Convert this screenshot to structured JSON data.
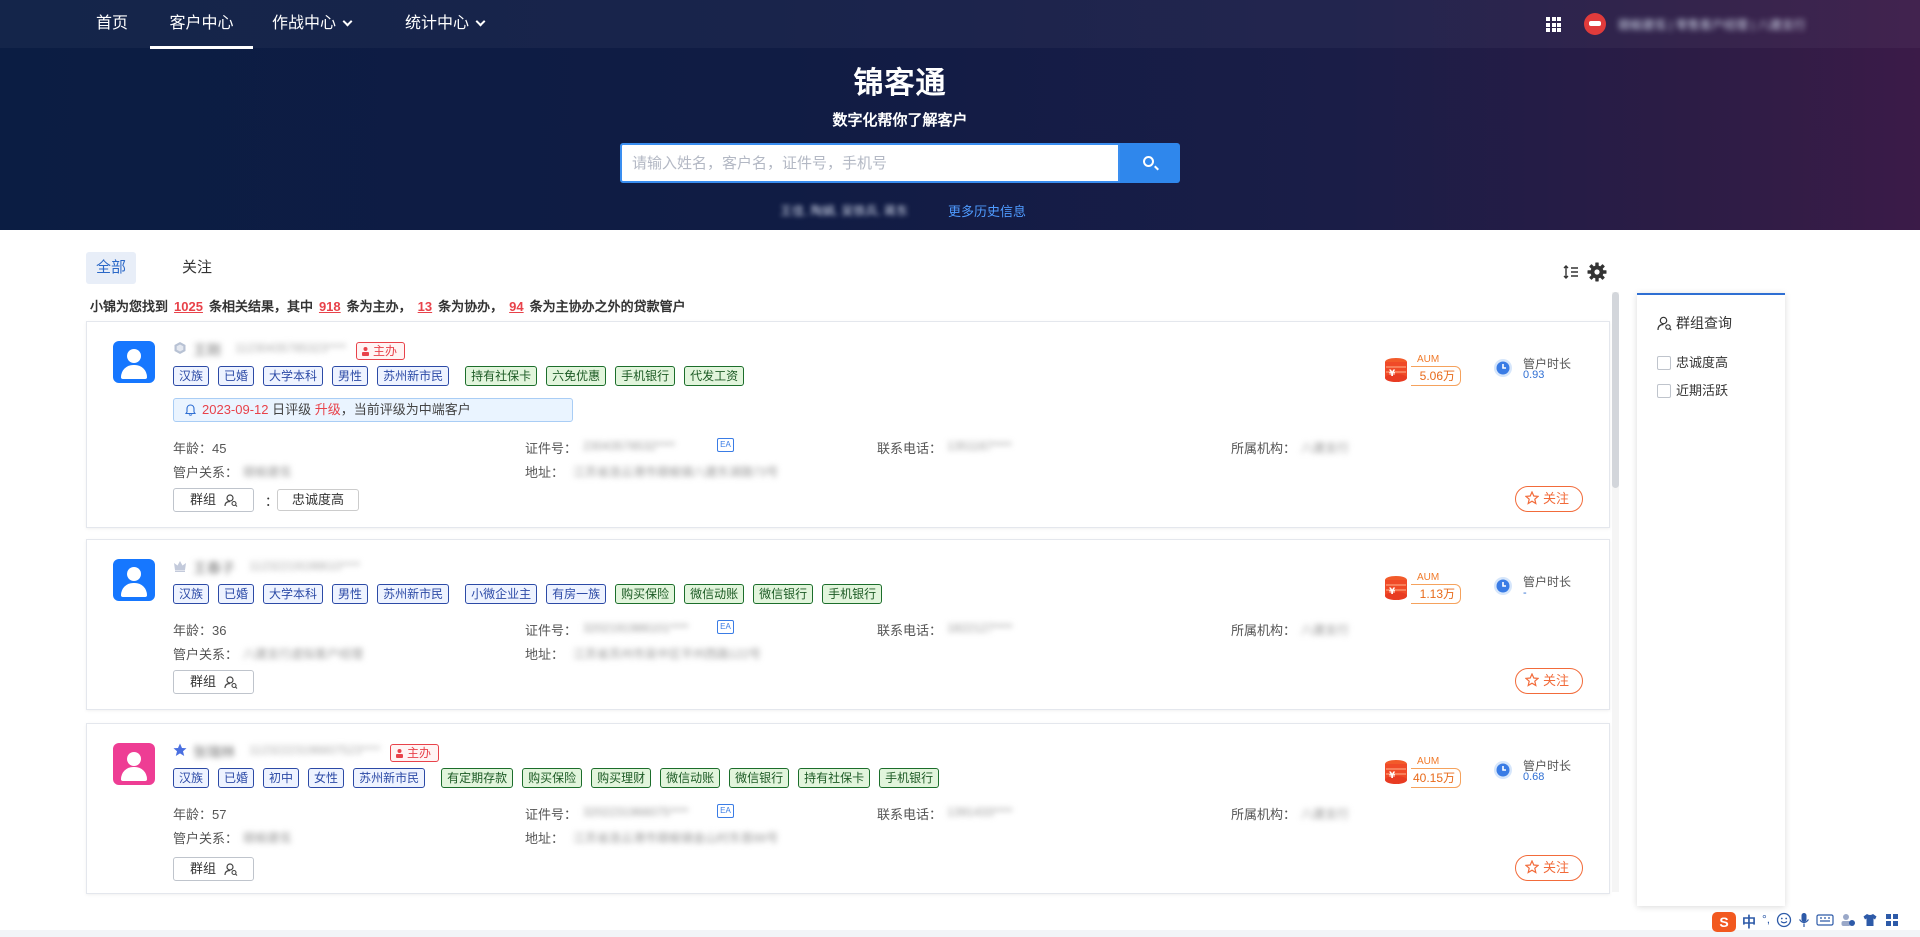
{
  "nav": {
    "home": "首页",
    "customer_center": "客户中心",
    "operations_center": "作战中心",
    "statistics_center": "统计中心",
    "user_name": "赣榆建瓴 | 零售客户经理 | 八建支行"
  },
  "brand": {
    "title": "锦客通",
    "subtitle": "数字化帮你了解客户"
  },
  "search": {
    "placeholder": "请输入姓名，客户名，证件号，手机号",
    "value": "",
    "history_hidden": "王佳, 陶娟, 吴铁兵, 蒋东",
    "history_link": "更多历史信息"
  },
  "tabs": [
    "全部",
    "关注"
  ],
  "summary": {
    "prefix": "小锦为您找到",
    "total": "1025",
    "mid1": "条相关结果，其中",
    "main_count": "918",
    "mid2": "条为主办，",
    "assist_count": "13",
    "mid3": "条为协办，",
    "other_count": "94",
    "suffix": "条为主协办之外的贷款管户"
  },
  "labels": {
    "age": "年龄：",
    "relation": "管户关系：",
    "id_no": "证件号：",
    "address": "地址：",
    "phone": "联系电话：",
    "org": "所属机构：",
    "group_btn": "群组",
    "colon": "：",
    "follow": "关注",
    "main_badge": "主办",
    "aum": "AUM",
    "tenure": "管户时长",
    "id_type": "EA"
  },
  "customers": [
    {
      "name": "王刚",
      "id_masked": "11230435785323****",
      "main_badge": true,
      "tags_blue": [
        "汉族",
        "已婚",
        "大学本科",
        "男性",
        "苏州新市民"
      ],
      "tags_green": [
        "持有社保卡",
        "六免优惠",
        "手机银行",
        "代发工资"
      ],
      "notice": {
        "date": "2023-09-12",
        "text1": "日评级",
        "up": "升级",
        "text2": "，当前评级为中端客户"
      },
      "age": "45",
      "relation": "赣榆建瓴",
      "id_no": "23043578532****",
      "address": "江苏省连云港市赣榆镇八建东湖路73号",
      "phone": "1351167****",
      "org": "八建支行",
      "group_tag": "忠诚度高",
      "aum": "5.06万",
      "tenure": "0.93"
    },
    {
      "name": "王春子",
      "id_masked": "11232219198610****",
      "main_badge": false,
      "tags_blue": [
        "汉族",
        "已婚",
        "大学本科",
        "男性",
        "苏州新市民",
        "小微企业主",
        "有房一族"
      ],
      "tags_green": [
        "购买保险",
        "微信动账",
        "微信银行",
        "手机银行"
      ],
      "age": "36",
      "relation": "八建支行虚拟客户经理",
      "id_no": "3202191986101****",
      "address": "江苏省苏州市吴中区平州西路122号",
      "phone": "1822127****",
      "org": "八建支行",
      "aum": "1.13万",
      "tenure": "-"
    },
    {
      "name": "张瑞林",
      "id_masked": "11232223196607523****",
      "main_badge": true,
      "tags_blue": [
        "汉族",
        "已婚",
        "初中",
        "女性",
        "苏州新市民"
      ],
      "tags_green": [
        "有定期存款",
        "购买保险",
        "购买理财",
        "微信动账",
        "微信银行",
        "持有社保卡",
        "手机银行"
      ],
      "age": "57",
      "relation": "赣榆建瓴",
      "id_no": "3202231966075****",
      "address": "江苏省连云港市赣榆镇金山村东首88号",
      "phone": "1391433****",
      "org": "八建支行",
      "aum": "40.15万",
      "tenure": "0.68"
    }
  ],
  "side_panel": {
    "title": "群组查询",
    "options": [
      "忠诚度高",
      "近期活跃"
    ]
  },
  "ime": {
    "logo": "S",
    "lang": "中",
    "punct": "°,"
  },
  "colors": {
    "accent": "#2f87ec",
    "highlight": "#e8424a",
    "follow": "#f26b3a",
    "tag_blue": "#2c4aa6",
    "tag_green": "#1c6e2b"
  }
}
